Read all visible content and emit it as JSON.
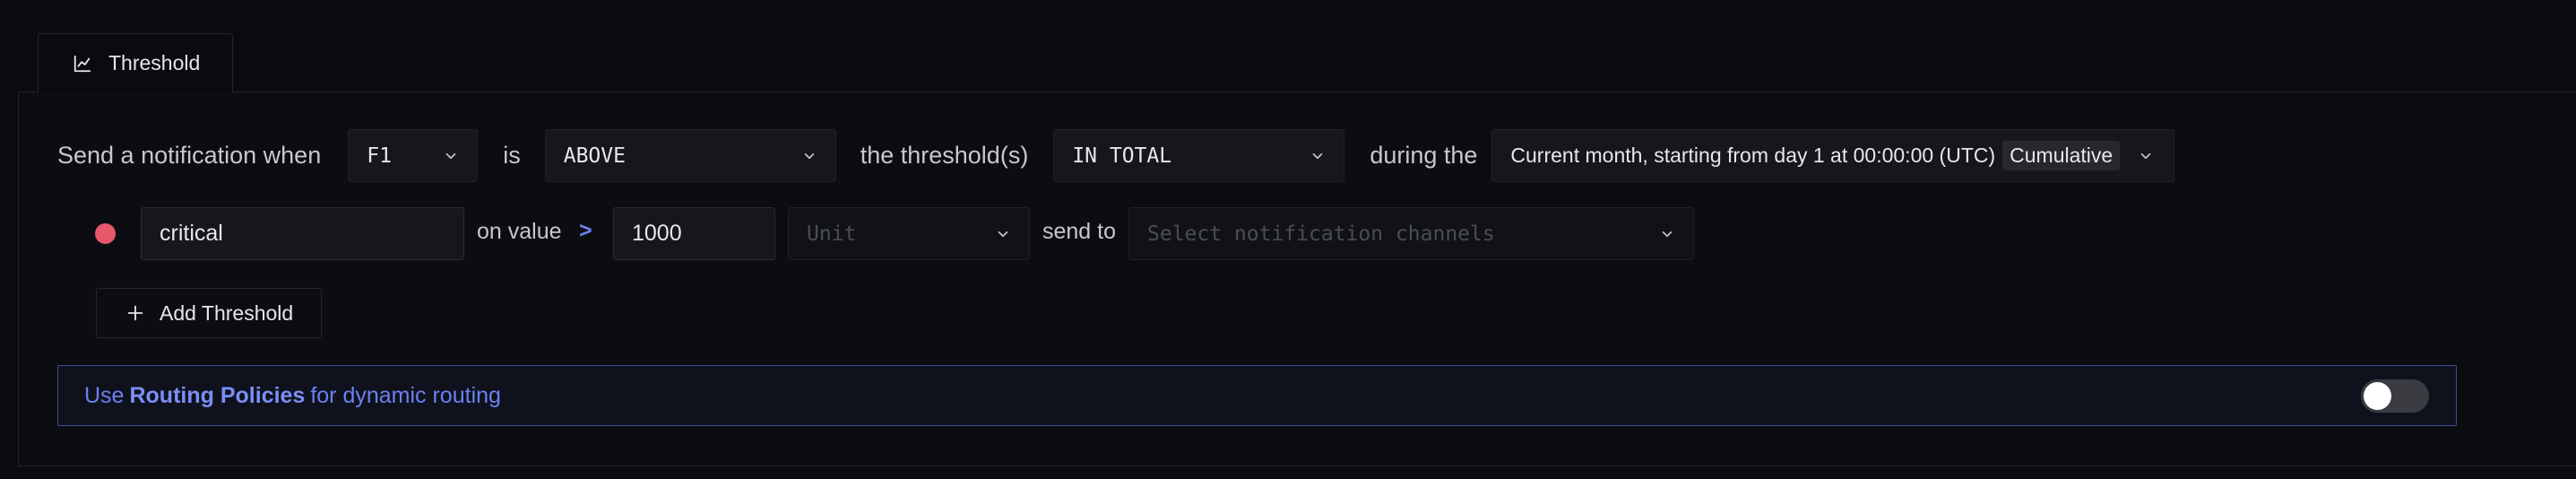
{
  "tab": {
    "label": "Threshold",
    "icon": "line-chart-icon"
  },
  "condition": {
    "prefix": "Send a notification when",
    "metric": "F1",
    "is_label": "is",
    "operator": "ABOVE",
    "threshold_label": "the threshold(s)",
    "match_type": "IN TOTAL",
    "during_label": "during the",
    "window": "Current month, starting from day 1 at 00:00:00 (UTC)",
    "window_badge": "Cumulative"
  },
  "threshold": {
    "color": "#e8566b",
    "name": "critical",
    "on_value_label": "on value",
    "comparator": ">",
    "value": "1000",
    "unit_placeholder": "Unit",
    "send_to_label": "send to",
    "channels_placeholder": "Select notification channels"
  },
  "add_threshold_label": "Add Threshold",
  "routing": {
    "prefix": "Use",
    "link": "Routing Policies",
    "suffix": "for dynamic routing",
    "enabled": false
  }
}
